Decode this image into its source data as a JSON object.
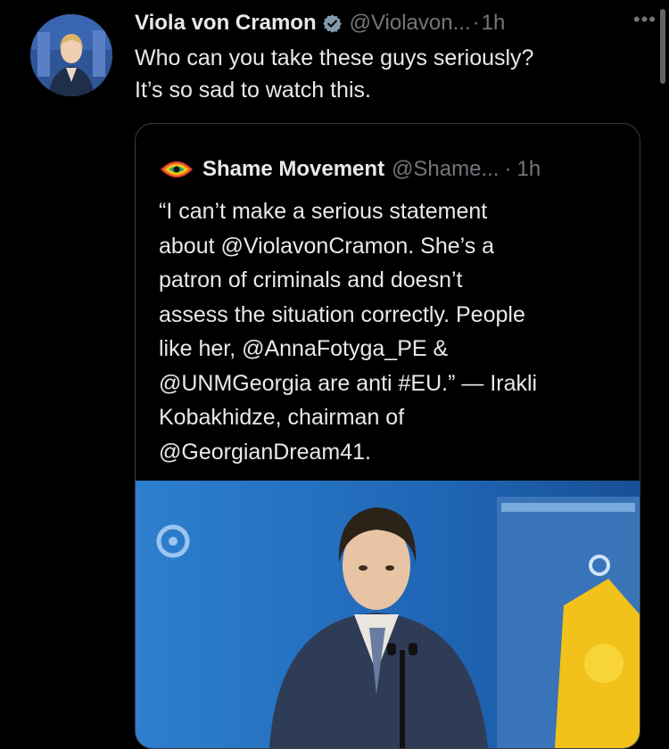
{
  "tweet": {
    "author_name": "Viola von Cramon",
    "author_handle": "@Violavon...",
    "separator": "·",
    "time": "1h",
    "more_icon": "more-dots-icon",
    "verified_icon": "verified-badge-icon",
    "text_lines": [
      "Who can you take these guys seriously?",
      "It’s so sad to watch this."
    ]
  },
  "quoted_tweet": {
    "author_name": "Shame Movement",
    "author_handle": "@Shame...",
    "separator": "·",
    "time": "1h",
    "text_lines": [
      "“I can’t make a serious statement",
      "about @ViolavonCramon. She’s a",
      "patron of criminals and doesn’t",
      "assess the situation correctly. People",
      "like her, @AnnaFotyga_PE &",
      "@UNMGeorgia are anti #EU.” — Irakli",
      "Kobakhidze, chairman of",
      "@GeorgianDream41."
    ]
  },
  "colors": {
    "background": "#000000",
    "text_primary": "#e7e9ea",
    "text_secondary": "#71767b",
    "verified": "#829aab",
    "border": "#3a3d41"
  }
}
